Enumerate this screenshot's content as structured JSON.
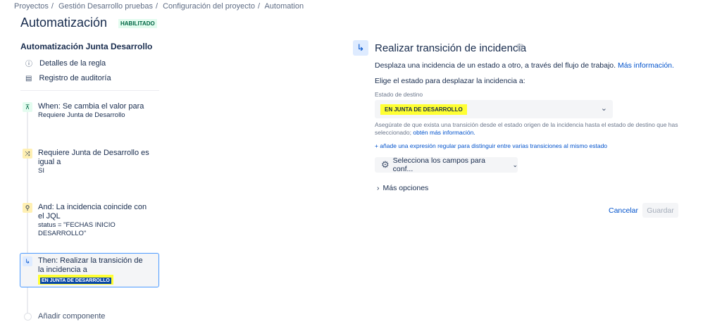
{
  "breadcrumb": [
    "Proyectos",
    "Gestión Desarrollo pruebas",
    "Configuración del proyecto",
    "Automation"
  ],
  "page_title": "Automatización",
  "status_badge": "HABILITADO",
  "sidebar": {
    "rule_name": "Automatización Junta Desarrollo",
    "items": [
      {
        "label": "Detalles de la regla",
        "icon": "info-icon"
      },
      {
        "label": "Registro de auditoría",
        "icon": "document-icon"
      }
    ],
    "steps": [
      {
        "title": "When: Se cambia el valor para",
        "detail": "Requiere Junta de Desarrollo",
        "icon": "trigger-icon"
      },
      {
        "title": "Requiere Junta de Desarrollo es igual a",
        "detail": "SI",
        "icon": "condition-icon"
      },
      {
        "title": "And: La incidencia coincide con el JQL",
        "detail": "status = \"FECHAS INICIO DESARROLLO\"",
        "icon": "search-icon"
      },
      {
        "title": "Then: Realizar la transición de la incidencia a",
        "detail": "EN JUNTA DE DESARROLLO",
        "icon": "transition-icon"
      }
    ],
    "add_component": "Añadir componente"
  },
  "panel": {
    "title": "Realizar transición de incidencia",
    "description": "Desplaza una incidencia de un estado a otro, a través del flujo de trabajo.",
    "more_info_link": "Más información.",
    "choose_label": "Elige el estado para desplazar la incidencia a:",
    "field_label": "Estado de destino",
    "selected_status": "EN JUNTA DE DESARROLLO",
    "hint": "Asegúrate de que exista una transición desde el estado origen de la incidencia hasta el estado de destino que has seleccionado;",
    "hint_link": "obtén más información.",
    "regex_link": "+ añade una expresión regular para distinguir entre varias transiciones al mismo estado",
    "fields_button": "Selecciona los campos para conf...",
    "more_options": "Más opciones",
    "cancel": "Cancelar",
    "save": "Guardar"
  }
}
